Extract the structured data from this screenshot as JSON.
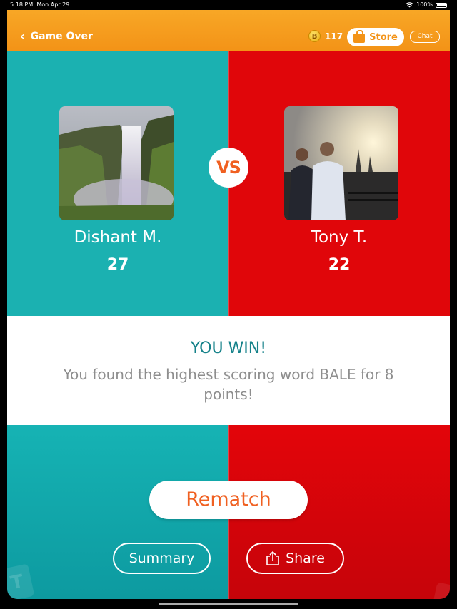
{
  "status_bar": {
    "time": "5:18 PM",
    "date": "Mon Apr 29",
    "signal": "....",
    "battery": "100%"
  },
  "header": {
    "back_label": "Game Over",
    "coin_symbol": "B",
    "coin_count": "117",
    "store_label": "Store",
    "chat_label": "Chat"
  },
  "match": {
    "vs_label": "VS",
    "player1": {
      "name": "Dishant M.",
      "score": "27"
    },
    "player2": {
      "name": "Tony T.",
      "score": "22"
    }
  },
  "result": {
    "title": "YOU WIN!",
    "message": "You found the highest scoring word BALE for 8 points!"
  },
  "actions": {
    "rematch_label": "Rematch",
    "summary_label": "Summary",
    "share_label": "Share"
  },
  "colors": {
    "teal": "#1bb1b1",
    "red": "#e0060a",
    "orange": "#f39317",
    "accent_text": "#f06021",
    "win_text": "#16828a"
  },
  "icons": {
    "back": "chevron-left-icon",
    "coin": "coin-icon",
    "store": "shopping-bag-icon",
    "share": "share-icon"
  }
}
